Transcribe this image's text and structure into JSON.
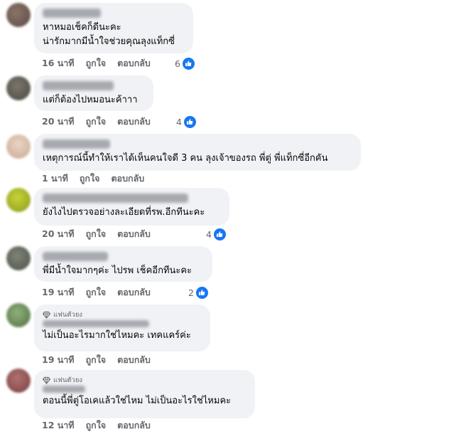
{
  "labels": {
    "like": "ถูกใจ",
    "reply": "ตอบกลับ"
  },
  "colors": {
    "bubble": "#f0f2f5",
    "meta_text": "#65676b",
    "like_blue": "#1877f2"
  },
  "comments": [
    {
      "lines": [
        "หาหมอเช็คก็ดีนะคะ",
        "น่ารักมากมีน้ำใจช่วยคุณลุงแท็กซี่"
      ],
      "time": "16 นาที",
      "reactions": "6",
      "badge": ""
    },
    {
      "lines": [
        "แต่ก็ต้องไปหมอนะค้าาา"
      ],
      "time": "20 นาที",
      "reactions": "4",
      "badge": ""
    },
    {
      "lines": [
        "เหตุการณ์นี้ทำให้เราได้เห็นคนใจดี 3 คน ลุงเจ้าของรถ พี่ตู่ พี่แท็กซี่อีกคัน"
      ],
      "time": "1 นาที",
      "reactions": "",
      "badge": ""
    },
    {
      "lines": [
        "ยังไงไปตรวจอย่างละเอียดที่รพ.อีกทีนะคะ"
      ],
      "time": "20 นาที",
      "reactions": "4",
      "badge": ""
    },
    {
      "lines": [
        "พี่มีน้ำใจมากๆค่ะ ไปรพ เช็คอีกทีนะคะ"
      ],
      "time": "19 นาที",
      "reactions": "2",
      "badge": ""
    },
    {
      "lines": [
        "ไม่เป็นอะไรมากใช่ไหมคะ เทคแคร์ค่ะ"
      ],
      "time": "19 นาที",
      "reactions": "",
      "badge": "แฟนตัวยง"
    },
    {
      "lines": [
        "ตอนนี้พี่ตู่โอเคแล้วใช่ไหม ไม่เป็นอะไรใช่ไหมคะ"
      ],
      "time": "12 นาที",
      "reactions": "",
      "badge": "แฟนตัวยง"
    }
  ]
}
